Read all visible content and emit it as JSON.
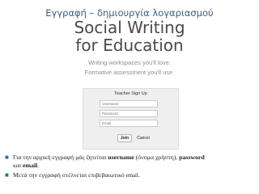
{
  "slide": {
    "title": "Εγγραφή – δημιουργία λογαριασμού"
  },
  "product": {
    "title_line1": "Social Writing",
    "title_line2": "for Education",
    "tagline_line1": "Writing workspaces you'll love.",
    "tagline_line2": "Formative assessment you'll use."
  },
  "signup": {
    "heading": "Teacher Sign Up",
    "username_placeholder": "Username",
    "password_placeholder": "Password",
    "email_placeholder": "Email",
    "join_label": "Join",
    "cancel_label": "Cancel"
  },
  "bullets": {
    "bullet1_part1": "Για την αρχική εγγραφή μάς ζητείται ",
    "bullet1_username": "username",
    "bullet1_part2": " (όνομα χρήστη), ",
    "bullet1_password": "password",
    "bullet1_part3": "και ",
    "bullet1_email": "email",
    "bullet1_end": ".",
    "bullet2_part1": "Μετά την εγγραφή στέλνεται επιβεβαιωτικό ",
    "bullet2_email": "email",
    "bullet2_end": "."
  },
  "icons": {
    "bullet_marker": "filled-square-bullet-icon"
  },
  "colors": {
    "slide_title": "#3a5f7d",
    "bullet_marker": "#2b6f8e"
  }
}
